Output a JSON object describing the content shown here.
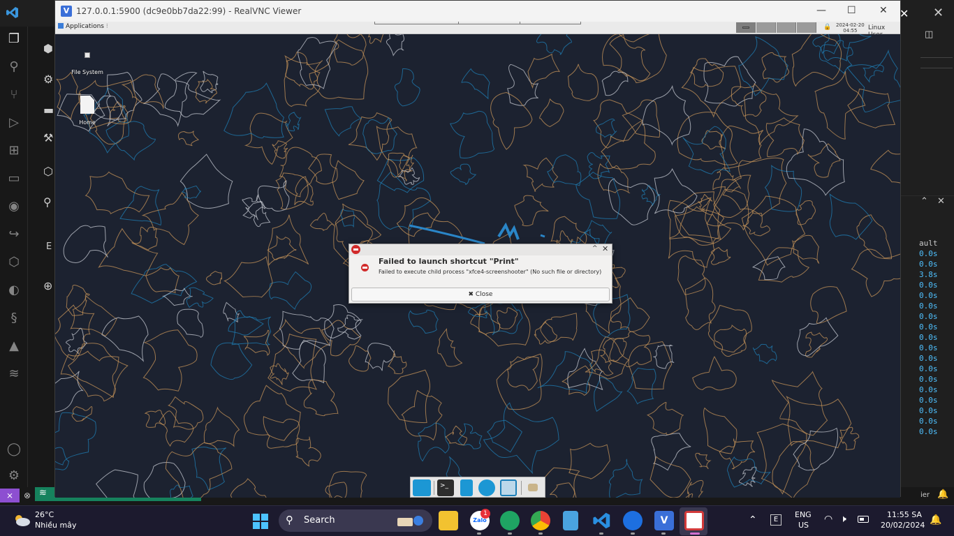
{
  "vnc_window": {
    "title": "127.0.0.1:5900 (dc9e0bb7da22:99) - RealVNC Viewer",
    "logo_glyph": "V",
    "minimize_glyph": "—",
    "maximize_glyph": "☐",
    "close_glyph": "✕"
  },
  "xfce_panel": {
    "applications_label": "Applications",
    "clock_date": "2024-02-20",
    "clock_time": "04:55",
    "user_label": "Linux User"
  },
  "desktop": {
    "icons": [
      {
        "label": "File System"
      },
      {
        "label": "Home"
      }
    ]
  },
  "dialog": {
    "heading": "Failed to launch shortcut \"Print\"",
    "message": "Failed to execute child process \"xfce4-screenshooter\" (No such file or directory)",
    "close_label": "✖ Close",
    "max_glyph": "^",
    "close_glyph": "✕"
  },
  "dock": {
    "items": [
      "show-desktop-icon",
      "terminal-icon",
      "files-icon",
      "web-browser-icon",
      "app-finder-icon",
      "folder-icon"
    ]
  },
  "vscode_bg": {
    "close_glyph": "✕",
    "panel_close_glyph": "✕",
    "explorer_letter": "E",
    "terminal_header": "ault",
    "terminal_lines": [
      "0.0s",
      "0.0s",
      "3.8s",
      "0.0s",
      "0.0s",
      "0.0s",
      "0.0s",
      "0.0s",
      "0.0s",
      "0.0s",
      "0.0s",
      "0.0s",
      "0.0s",
      "0.0s",
      "0.0s",
      "0.0s",
      "0.0s",
      "0.0s"
    ],
    "status_right": "ier"
  },
  "taskbar": {
    "weather_temp": "26°C",
    "weather_desc": "Nhiều mây",
    "search_label": "Search",
    "zalo_badge": "1",
    "lang_line1": "ENG",
    "lang_line2": "US",
    "ime_glyph": "E",
    "time": "11:55 SA",
    "date": "20/02/2024"
  },
  "colors": {
    "wallpaper_bg": "#1c2230",
    "contour_orange": "#c8955a",
    "contour_blue": "#1f7fb5",
    "contour_white": "#c8ccd4",
    "error_red": "#d12b2b",
    "vscode_accent": "#3a96dd"
  }
}
